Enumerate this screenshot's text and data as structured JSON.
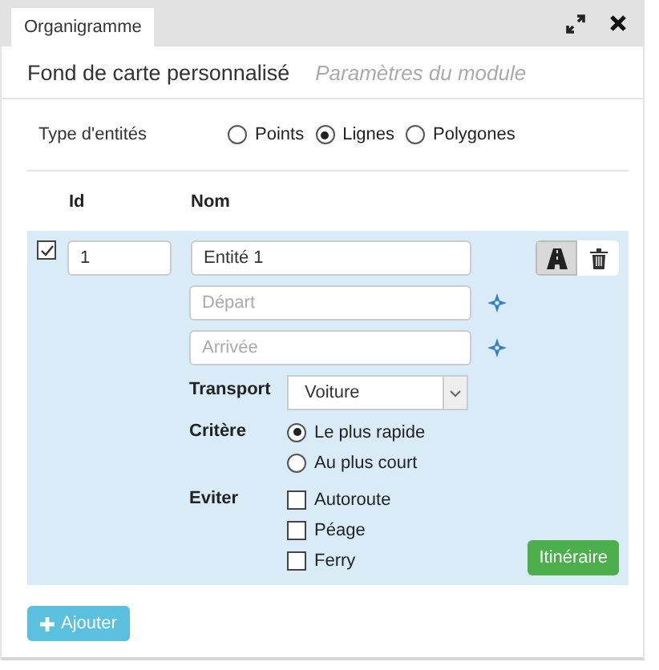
{
  "tab": {
    "label": "Organigramme",
    "selected": true
  },
  "header": {
    "title": "Fond de carte personnalisé",
    "subtitle": "Paramètres du module"
  },
  "entity_type": {
    "label": "Type d'entités",
    "options": [
      {
        "label": "Points",
        "selected": false
      },
      {
        "label": "Lignes",
        "selected": true
      },
      {
        "label": "Polygones",
        "selected": false
      }
    ]
  },
  "columns": [
    "Id",
    "Nom"
  ],
  "entity": {
    "checked": true,
    "id": "1",
    "name": "Entité 1",
    "departure": {
      "placeholder": "Départ"
    },
    "arrival": {
      "placeholder": "Arrivée"
    },
    "transport": {
      "label": "Transport",
      "value": "Voiture"
    },
    "criterion": {
      "label": "Critère",
      "options": [
        {
          "label": "Le plus rapide",
          "selected": true
        },
        {
          "label": "Au plus court",
          "selected": false
        }
      ]
    },
    "avoid": {
      "label": "Eviter",
      "options": [
        {
          "label": "Autoroute",
          "checked": false
        },
        {
          "label": "Péage",
          "checked": false
        },
        {
          "label": "Ferry",
          "checked": false
        }
      ]
    },
    "route_button": "Itinéraire"
  },
  "add_button": "Ajouter"
}
